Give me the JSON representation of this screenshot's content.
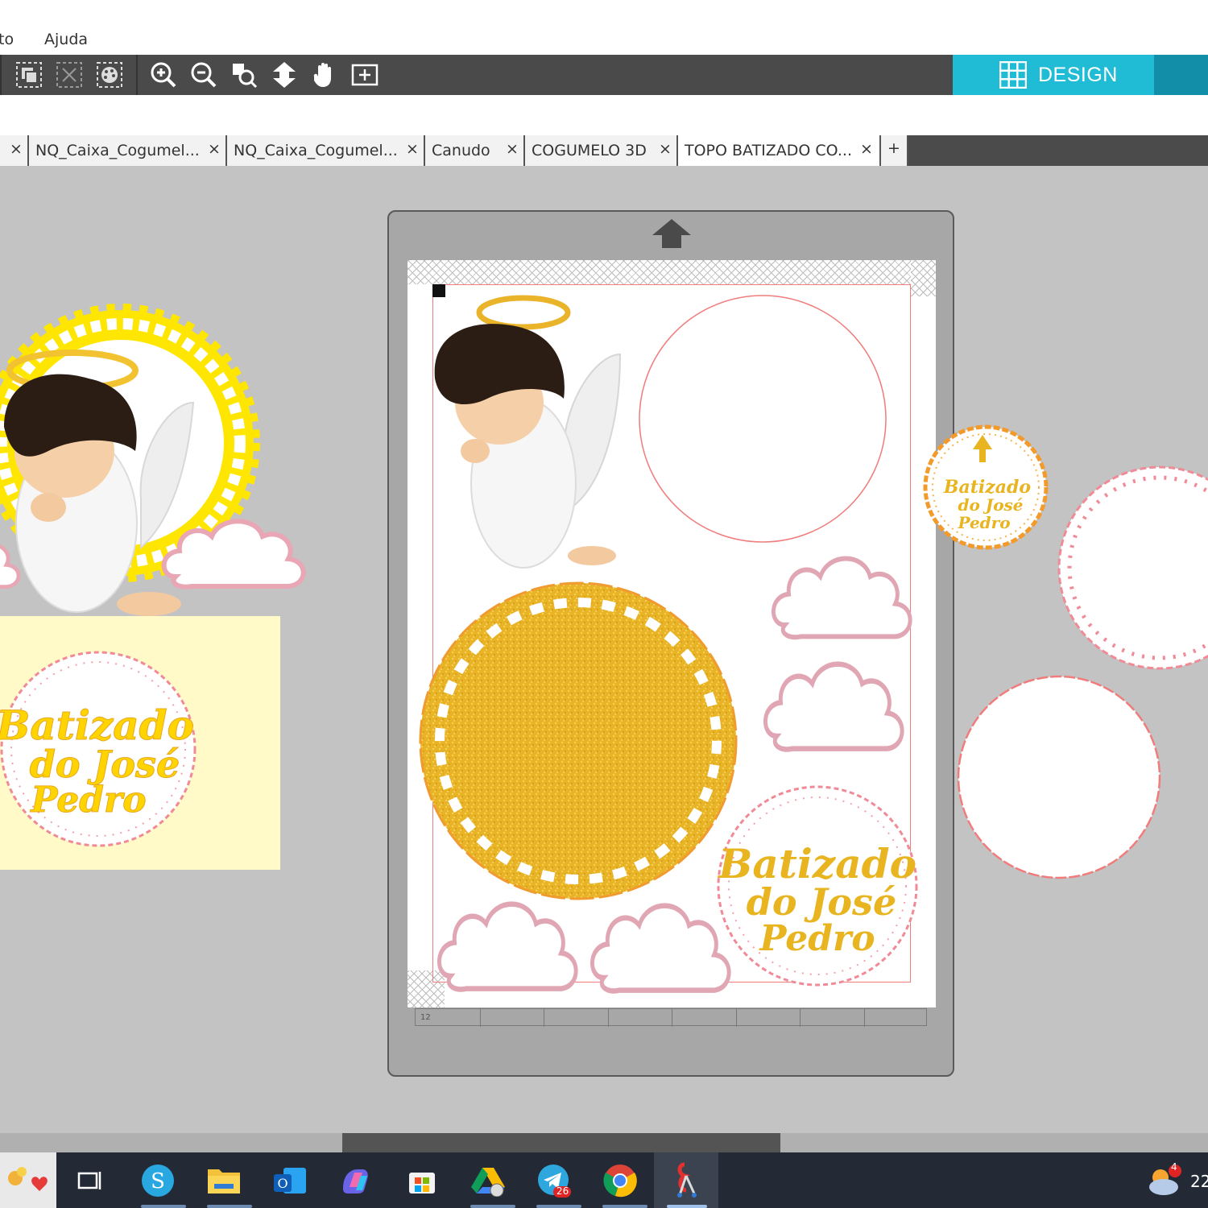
{
  "menu": {
    "items": [
      "to",
      "Ajuda"
    ]
  },
  "toolbar": {
    "tools": [
      "group-tool",
      "ungroup-tool",
      "style-tool",
      "zoom-in-tool",
      "zoom-out-tool",
      "zoom-fit-tool",
      "move-down-tool",
      "pan-tool",
      "fit-page-tool"
    ],
    "design_label": "DESIGN"
  },
  "tabs": [
    {
      "label": "NQ_Caixa_Cogumel...",
      "active": false
    },
    {
      "label": "NQ_Caixa_Cogumel...",
      "active": false
    },
    {
      "label": "Canudo",
      "active": false
    },
    {
      "label": "COGUMELO 3D",
      "active": false
    },
    {
      "label": "TOPO BATIZADO CO...",
      "active": true
    }
  ],
  "tab_close_glyph": "×",
  "tab_add_glyph": "+",
  "design": {
    "title_line1": "Batizado",
    "title_line2": "do José",
    "title_line3": "Pedro"
  },
  "ruler": {
    "tick_label": "12"
  },
  "taskbar": {
    "icons": [
      "start-icon",
      "task-view-icon",
      "silhouette-icon",
      "file-explorer-icon",
      "outlook-icon",
      "copilot-icon",
      "store-icon",
      "google-drive-icon",
      "telegram-icon",
      "chrome-icon",
      "cutting-app-icon"
    ],
    "telegram_badge": "26",
    "weather_badge": "4",
    "clock": "22"
  },
  "colors": {
    "design_accent": "#20bcd6",
    "gold": "#e8b420",
    "yellow": "#ffe600",
    "cut_line": "#f07c7c"
  }
}
